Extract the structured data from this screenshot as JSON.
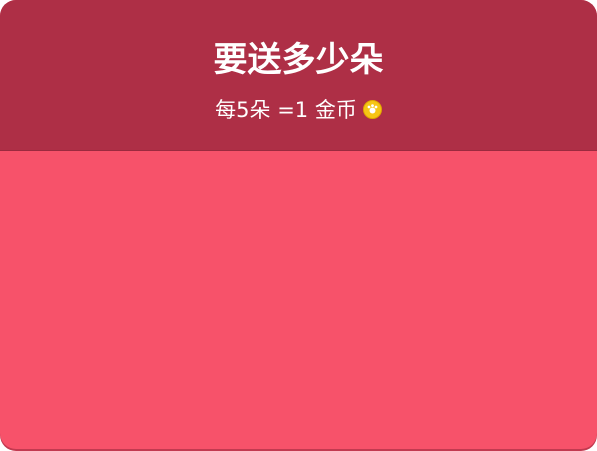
{
  "dialog": {
    "title": "要送多少朵",
    "rate": {
      "prefix": "每5朵 ",
      "equals": "=1 金币"
    },
    "coin_icon": "coin-icon",
    "colors": {
      "header": "#ae2f46",
      "body": "#f7526a",
      "text": "#ffffff",
      "coin": "#f6c515"
    }
  }
}
